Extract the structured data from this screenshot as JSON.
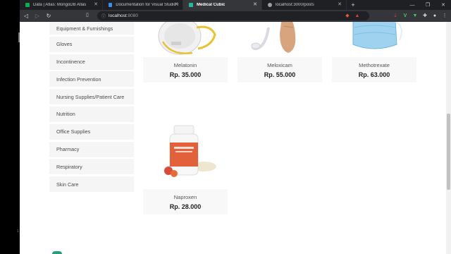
{
  "browser": {
    "tabs": [
      {
        "label": "Data | Atlas: MongoDB Atlas",
        "color": "#13aa52",
        "active": false
      },
      {
        "label": "Documentation for Visual Studio Code",
        "color": "#3a8ee6",
        "active": false
      },
      {
        "label": "Medical Cubic",
        "color": "#2bb5a0",
        "active": true
      },
      {
        "label": "localhost:3000/posts",
        "color": "#9aa0a6",
        "active": false
      }
    ],
    "url_host": "localhost",
    "url_port": ":8080"
  },
  "sidebar": {
    "categories": [
      "Equipment & Furnishings",
      "Gloves",
      "Incontinence",
      "Infection Prevention",
      "Nursing Supplies/Patient Care",
      "Nutrition",
      "Office Supplies",
      "Pharmacy",
      "Respiratory",
      "Skin Care"
    ]
  },
  "products": [
    {
      "name": "Melatonin",
      "price": "Rp. 35.000",
      "image": "mask-icon"
    },
    {
      "name": "Meloxicam",
      "price": "Rp. 55.000",
      "image": "hearing-aid-icon"
    },
    {
      "name": "Methotrexate",
      "price": "Rp. 63.000",
      "image": "surgical-mask-icon"
    },
    {
      "name": "Naproxen",
      "price": "Rp. 28.000",
      "image": "supplement-bottle-icon"
    }
  ],
  "left_margin_number": "1"
}
